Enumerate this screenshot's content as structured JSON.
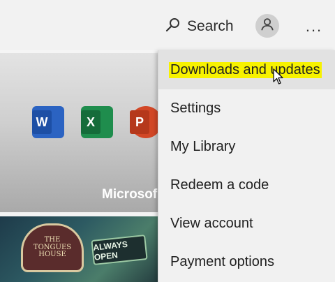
{
  "topbar": {
    "search_label": "Search",
    "search_icon": "search-icon",
    "account_icon": "person-icon",
    "more_label": "..."
  },
  "hero": {
    "title": "Microsof",
    "apps": [
      {
        "name": "word-icon",
        "letter": "W",
        "color": "#2b63c2"
      },
      {
        "name": "excel-icon",
        "letter": "X",
        "color": "#1f8d4d"
      },
      {
        "name": "powerpoint-icon",
        "letter": "P",
        "color": "#d24726"
      }
    ]
  },
  "game_card": {
    "badge_text": "THE\nTONGUES\nHOUSE",
    "sign_text": "ALWAYS OPEN"
  },
  "menu": {
    "items": [
      {
        "label": "Downloads and updates",
        "highlighted": true
      },
      {
        "label": "Settings"
      },
      {
        "label": "My Library"
      },
      {
        "label": "Redeem a code"
      },
      {
        "label": "View account"
      },
      {
        "label": "Payment options"
      }
    ],
    "highlight_color": "#f7f200"
  }
}
